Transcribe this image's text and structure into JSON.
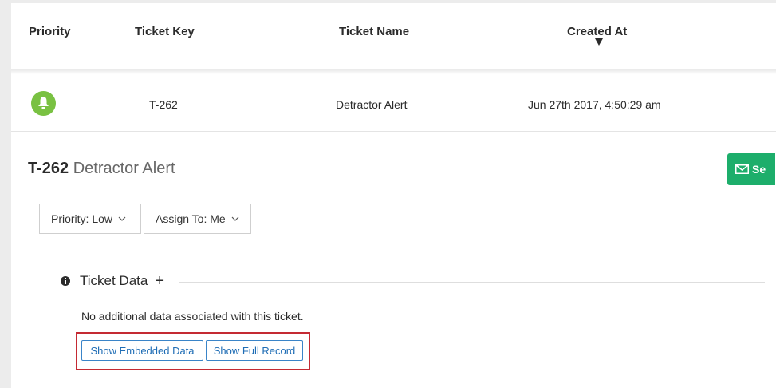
{
  "table": {
    "headers": {
      "priority": "Priority",
      "ticket_key": "Ticket Key",
      "ticket_name": "Ticket Name",
      "created_at": "Created At"
    },
    "sort_icon": "caret-down-icon",
    "rows": [
      {
        "priority_icon": "bell-icon",
        "priority_color": "#79c142",
        "ticket_key": "T-262",
        "ticket_name": "Detractor Alert",
        "created_at": "Jun 27th 2017, 4:50:29 am"
      }
    ]
  },
  "detail": {
    "ticket_key": "T-262",
    "ticket_name": "Detractor Alert",
    "send_button_label": "Se",
    "send_button_color": "#1dae6b",
    "priority_dropdown": "Priority: Low",
    "assign_dropdown": "Assign To: Me",
    "section_title": "Ticket Data",
    "section_add_symbol": "+",
    "no_data_text": "No additional data associated with this ticket.",
    "show_embedded_label": "Show Embedded Data",
    "show_full_record_label": "Show Full Record",
    "highlight_color": "#c42a33"
  }
}
